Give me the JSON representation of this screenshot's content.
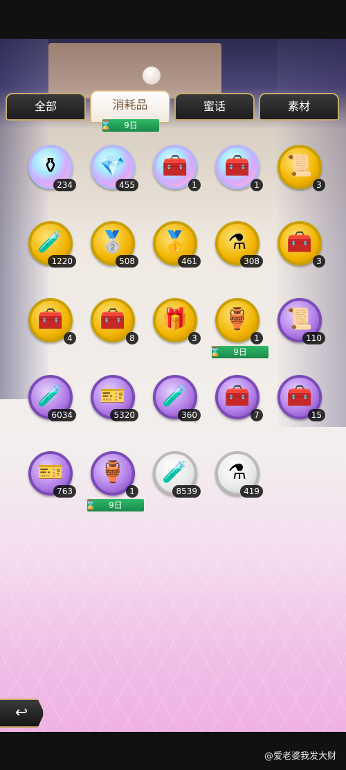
{
  "tabs": [
    {
      "label": "全部"
    },
    {
      "label": "消耗品"
    },
    {
      "label": "蜜话"
    },
    {
      "label": "素材"
    }
  ],
  "tab_timer": "9日",
  "items": [
    {
      "icon": "rainbow-potion-icon",
      "count": "234",
      "glyph": "⚱",
      "style": "rainbow"
    },
    {
      "icon": "rainbow-crystal-icon",
      "count": "455",
      "glyph": "💎",
      "style": "rainbow"
    },
    {
      "icon": "rainbow-chest-icon",
      "count": "1",
      "glyph": "🧰",
      "style": "rainbow"
    },
    {
      "icon": "red-treasure-chest-icon",
      "count": "1",
      "glyph": "🧰",
      "style": "rainbow"
    },
    {
      "icon": "scroll-bundle-icon",
      "count": "3",
      "glyph": "📜",
      "style": "gold"
    },
    {
      "icon": "green-potion-icon",
      "count": "1220",
      "glyph": "🧪",
      "style": "gold"
    },
    {
      "icon": "silver-ingot-icon",
      "count": "508",
      "glyph": "🥈",
      "style": "gold"
    },
    {
      "icon": "gold-ingot-icon",
      "count": "461",
      "glyph": "🥇",
      "style": "gold"
    },
    {
      "icon": "purple-potion-icon",
      "count": "308",
      "glyph": "⚗",
      "style": "gold"
    },
    {
      "icon": "purple-chest-icon",
      "count": "3",
      "glyph": "🧰",
      "style": "gold"
    },
    {
      "icon": "purple-chest-small-icon",
      "count": "4",
      "glyph": "🧰",
      "style": "gold"
    },
    {
      "icon": "green-chest-icon",
      "count": "8",
      "glyph": "🧰",
      "style": "gold"
    },
    {
      "icon": "gift-box-icon",
      "count": "3",
      "glyph": "🎁",
      "style": "gold"
    },
    {
      "icon": "red-elixir-icon",
      "count": "1",
      "glyph": "🏺",
      "style": "gold",
      "timer": "9日"
    },
    {
      "icon": "scroll-icon",
      "count": "110",
      "glyph": "📜",
      "style": "purple"
    },
    {
      "icon": "green-potion-purple-icon",
      "count": "6034",
      "glyph": "🧪",
      "style": "purple"
    },
    {
      "icon": "ticket-icon",
      "count": "5320",
      "glyph": "🎫",
      "style": "purple"
    },
    {
      "icon": "blue-potion-icon",
      "count": "360",
      "glyph": "🧪",
      "style": "purple"
    },
    {
      "icon": "wooden-chest-icon",
      "count": "7",
      "glyph": "🧰",
      "style": "purple"
    },
    {
      "icon": "green-chest-purple-icon",
      "count": "15",
      "glyph": "🧰",
      "style": "purple"
    },
    {
      "icon": "green-ticket-icon",
      "count": "763",
      "glyph": "🎫",
      "style": "purple"
    },
    {
      "icon": "red-potion-icon",
      "count": "1",
      "glyph": "🏺",
      "style": "purple",
      "timer": "9日"
    },
    {
      "icon": "green-vial-icon",
      "count": "8539",
      "glyph": "🧪",
      "style": "silver"
    },
    {
      "icon": "purple-vial-icon",
      "count": "419",
      "glyph": "⚗",
      "style": "silver"
    }
  ],
  "back_label": "↩",
  "watermark": "@爱老婆我发大财"
}
